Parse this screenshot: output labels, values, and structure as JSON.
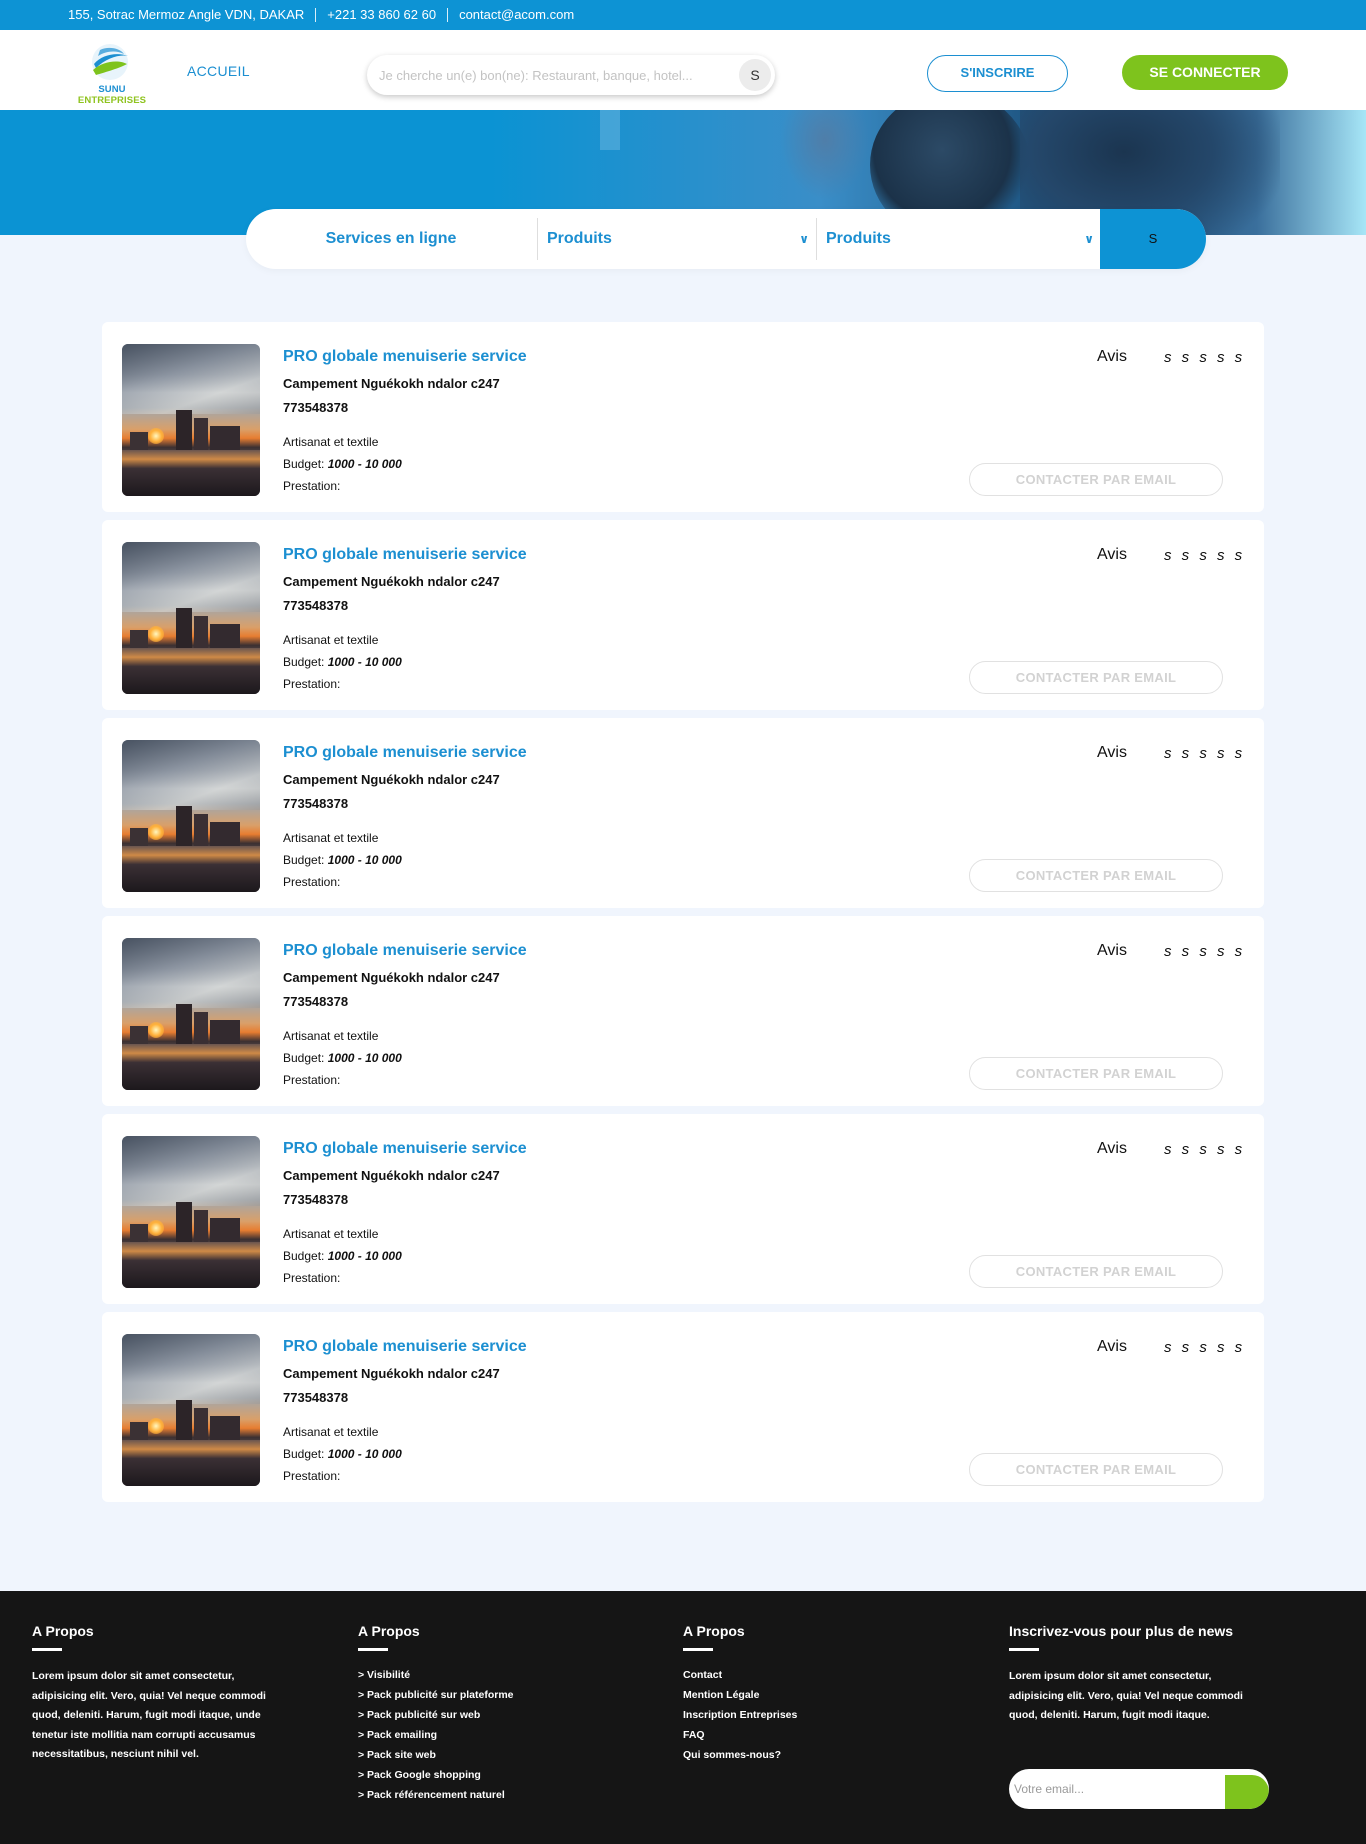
{
  "topbar": {
    "address": "155, Sotrac Mermoz Angle VDN, DAKAR",
    "phone": "+221 33 860 62 60",
    "email": "contact@acom.com"
  },
  "brand": {
    "name_part1": "SUNU",
    "name_part2": "ENTREPRISES",
    "primary_color": "#0d93d4",
    "accent_color": "#7ec31d"
  },
  "nav": {
    "home": "ACCUEIL"
  },
  "search": {
    "placeholder": "Je cherche un(e) bon(ne): Restaurant, banque, hotel...",
    "button_label": "S"
  },
  "auth": {
    "signup": "S'INSCRIRE",
    "login": "SE CONNECTER"
  },
  "filter": {
    "tab": "Services en ligne",
    "select1": "Produits",
    "select2": "Produits",
    "button_label": "S"
  },
  "listings": [
    {
      "title": "PRO globale menuiserie service",
      "address": "Campement Nguékokh ndalor c247",
      "phone": "773548378",
      "category": "Artisanat et textile",
      "budget_label": "Budget:",
      "budget_value": "1000 - 10 000",
      "prestation_label": "Prestation:",
      "avis": "Avis",
      "stars": "s s s s s",
      "contact": "CONTACTER PAR EMAIL"
    },
    {
      "title": "PRO globale menuiserie service",
      "address": "Campement Nguékokh ndalor c247",
      "phone": "773548378",
      "category": "Artisanat et textile",
      "budget_label": "Budget:",
      "budget_value": "1000 - 10 000",
      "prestation_label": "Prestation:",
      "avis": "Avis",
      "stars": "s s s s s",
      "contact": "CONTACTER PAR EMAIL"
    },
    {
      "title": "PRO globale menuiserie service",
      "address": "Campement Nguékokh ndalor c247",
      "phone": "773548378",
      "category": "Artisanat et textile",
      "budget_label": "Budget:",
      "budget_value": "1000 - 10 000",
      "prestation_label": "Prestation:",
      "avis": "Avis",
      "stars": "s s s s s",
      "contact": "CONTACTER PAR EMAIL"
    },
    {
      "title": "PRO globale menuiserie service",
      "address": "Campement Nguékokh ndalor c247",
      "phone": "773548378",
      "category": "Artisanat et textile",
      "budget_label": "Budget:",
      "budget_value": "1000 - 10 000",
      "prestation_label": "Prestation:",
      "avis": "Avis",
      "stars": "s s s s s",
      "contact": "CONTACTER PAR EMAIL"
    },
    {
      "title": "PRO globale menuiserie service",
      "address": "Campement Nguékokh ndalor c247",
      "phone": "773548378",
      "category": "Artisanat et textile",
      "budget_label": "Budget:",
      "budget_value": "1000 - 10 000",
      "prestation_label": "Prestation:",
      "avis": "Avis",
      "stars": "s s s s s",
      "contact": "CONTACTER PAR EMAIL"
    },
    {
      "title": "PRO globale menuiserie service",
      "address": "Campement Nguékokh ndalor c247",
      "phone": "773548378",
      "category": "Artisanat et textile",
      "budget_label": "Budget:",
      "budget_value": "1000 - 10 000",
      "prestation_label": "Prestation:",
      "avis": "Avis",
      "stars": "s s s s s",
      "contact": "CONTACTER PAR EMAIL"
    }
  ],
  "footer": {
    "col1": {
      "title": "A Propos",
      "text": "Lorem ipsum dolor sit amet consectetur, adipisicing elit. Vero, quia! Vel neque commodi quod, deleniti. Harum, fugit modi itaque, unde tenetur iste mollitia nam corrupti accusamus necessitatibus, nesciunt nihil vel."
    },
    "col2": {
      "title": "A Propos",
      "links": [
        "> Visibilité",
        "> Pack publicité sur plateforme",
        "> Pack publicité sur web",
        "> Pack emailing",
        "> Pack site web",
        "> Pack Google shopping",
        "> Pack référencement naturel"
      ]
    },
    "col3": {
      "title": "A Propos",
      "links": [
        "Contact",
        "Mention Légale",
        "Inscription Entreprises",
        "FAQ",
        "Qui sommes-nous?"
      ]
    },
    "col4": {
      "title": "Inscrivez-vous pour plus de news",
      "text": "Lorem ipsum dolor sit amet consectetur, adipisicing elit. Vero, quia! Vel neque commodi quod, deleniti. Harum, fugit modi itaque.",
      "email_placeholder": "Votre email..."
    }
  }
}
